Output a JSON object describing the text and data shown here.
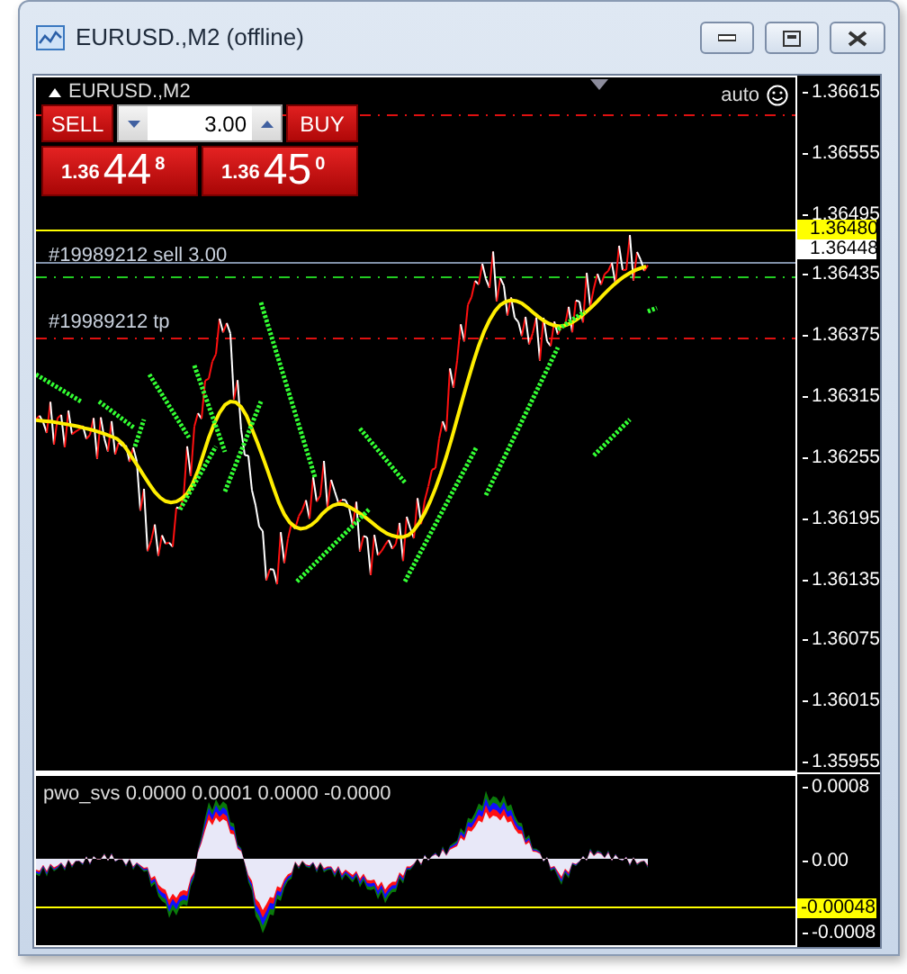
{
  "window": {
    "title": "EURUSD.,M2 (offline)"
  },
  "chart": {
    "symbol": "EURUSD.,M2",
    "auto_label": "auto",
    "trade_panel": {
      "sell_label": "SELL",
      "buy_label": "BUY",
      "volume": "3.00",
      "sell_price": {
        "prefix": "1.36",
        "big": "44",
        "sup": "8"
      },
      "buy_price": {
        "prefix": "1.36",
        "big": "45",
        "sup": "0"
      }
    },
    "order_labels": [
      {
        "text": "#19989212 sell 3.00",
        "kind": "entry"
      },
      {
        "text": "#19989212 tp",
        "kind": "tp"
      }
    ],
    "price_axis": {
      "labels": [
        "1.36615",
        "1.36555",
        "1.36495",
        "1.36435",
        "1.36375",
        "1.36315",
        "1.36255",
        "1.36195",
        "1.36135",
        "1.36075",
        "1.36015",
        "1.35955"
      ],
      "markers": [
        {
          "text": "1.36480",
          "kind": "ask"
        },
        {
          "text": "1.36448",
          "kind": "bid"
        }
      ]
    }
  },
  "indicator": {
    "title": "pwo_svs 0.0000 0.0001 0.0000 -0.0000",
    "axis_labels": [
      "0.0008",
      "0.00",
      "-0.0008"
    ],
    "marker": "-0.00048"
  }
}
